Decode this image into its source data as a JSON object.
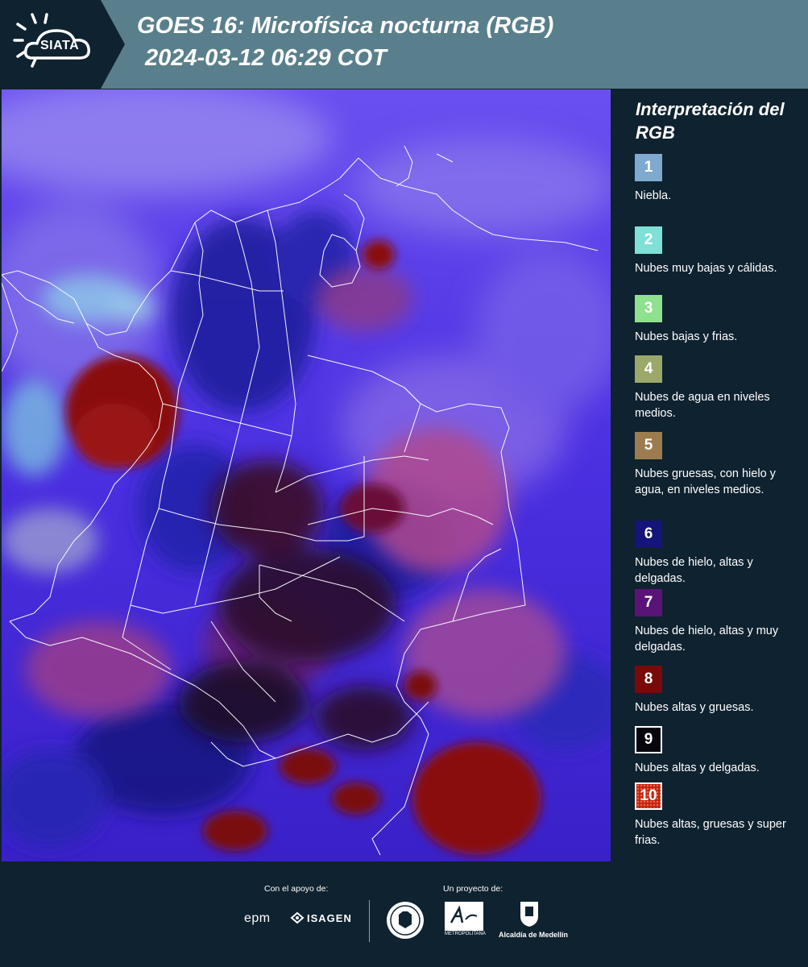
{
  "header": {
    "logo_text": "SIATA",
    "title_line1": "GOES 16: Microfísica nocturna (RGB)",
    "title_line2": "2024-03-12 06:29 COT"
  },
  "legend": {
    "title": "Interpretación del RGB",
    "items": [
      {
        "number": "1",
        "label": "Niebla.",
        "color": "#7fa9cf",
        "text_color": "#ffffff"
      },
      {
        "number": "2",
        "label": "Nubes muy bajas y cálidas.",
        "color": "#7fe0d8",
        "text_color": "#ffffff"
      },
      {
        "number": "3",
        "label": "Nubes bajas y frias.",
        "color": "#8fe08f",
        "text_color": "#ffffff"
      },
      {
        "number": "4",
        "label": "Nubes de agua en niveles medios.",
        "color": "#9aa86a",
        "text_color": "#ffffff"
      },
      {
        "number": "5",
        "label": "Nubes gruesas, con hielo y agua, en niveles medios.",
        "color": "#9c7c4e",
        "text_color": "#ffffff"
      },
      {
        "number": "6",
        "label": "Nubes de hielo, altas y delgadas.",
        "color": "#14147a",
        "text_color": "#ffffff"
      },
      {
        "number": "7",
        "label": "Nubes de hielo, altas y muy delgadas.",
        "color": "#5a1478",
        "text_color": "#ffffff"
      },
      {
        "number": "8",
        "label": "Nubes altas y gruesas.",
        "color": "#7a0a0a",
        "text_color": "#ffffff"
      },
      {
        "number": "9",
        "label": "Nubes altas y delgadas.",
        "color": "#06060c",
        "text_color": "#ffffff"
      },
      {
        "number": "10",
        "label": "Nubes altas, gruesas y super frias.",
        "color": "#c4200c",
        "text_color": "#ffffff"
      }
    ]
  },
  "footer": {
    "support_caption": "Con el apoyo de:",
    "project_caption": "Un proyecto de:",
    "sponsors": [
      "epm",
      "ISAGEN"
    ],
    "partners": [
      "METROPOLITANA",
      "Alcaldía de Medellín"
    ]
  },
  "colors": {
    "header_bg": "#5a7f8c",
    "panel_bg": "#0f2230",
    "map_base": "#4b2fd6"
  }
}
